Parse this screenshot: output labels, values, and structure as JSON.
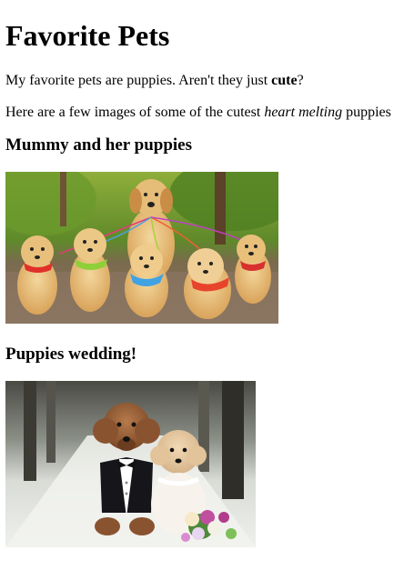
{
  "heading": "Favorite Pets",
  "intro": {
    "before": "My favorite pets are puppies. Aren't they just ",
    "bold": "cute",
    "after": "?"
  },
  "second": {
    "before": "Here are a few images of some of the cutest ",
    "italic": "heart melting",
    "after": " puppies"
  },
  "sections": [
    {
      "title": "Mummy and her puppies",
      "image": "golden-retriever-puppies-photo"
    },
    {
      "title": "Puppies wedding!",
      "image": "poodle-wedding-photo"
    }
  ]
}
